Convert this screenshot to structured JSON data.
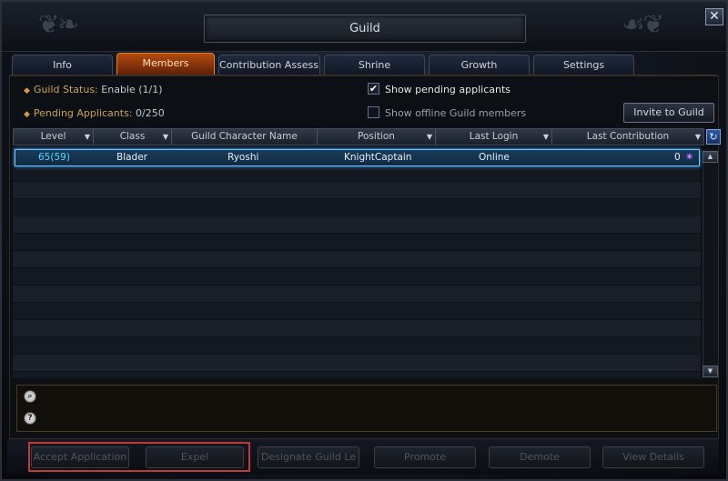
{
  "window": {
    "title": "Guild",
    "close_icon": "close-icon"
  },
  "tabs": [
    {
      "label": "Info",
      "active": false
    },
    {
      "label": "Members",
      "active": true
    },
    {
      "label": "Contribution Assessi",
      "active": false
    },
    {
      "label": "Shrine",
      "active": false
    },
    {
      "label": "Growth",
      "active": false
    },
    {
      "label": "Settings",
      "active": false
    }
  ],
  "status": {
    "guild_status_label": "Guild Status:",
    "guild_status_value": " Enable (1/1)",
    "pending_label": "Pending Applicants:",
    "pending_value": " 0/250"
  },
  "options": {
    "show_pending": {
      "label": "Show pending applicants",
      "checked": true
    },
    "show_offline": {
      "label": "Show offline Guild members",
      "checked": false
    }
  },
  "invite_button": "Invite to Guild",
  "table": {
    "columns": [
      "Level",
      "Class",
      "Guild Character Name",
      "Position",
      "Last Login",
      "Last Contribution"
    ],
    "rows": [
      {
        "level": "65(59)",
        "class": "Blader",
        "name": "Ryoshi",
        "position": "KnightCaptain",
        "last_login": "Online",
        "last_contribution": "0"
      }
    ]
  },
  "actions": {
    "accept": "Accept Application",
    "expel": "Expel",
    "designate": "Designate Guild Le",
    "promote": "Promote",
    "demote": "Demote",
    "view_details": "View Details"
  },
  "colors": {
    "accent_tab": "#b44a10",
    "selection_border": "#6fc7ff",
    "level_text": "#58d7ff",
    "highlight_box": "#c23a3a"
  }
}
